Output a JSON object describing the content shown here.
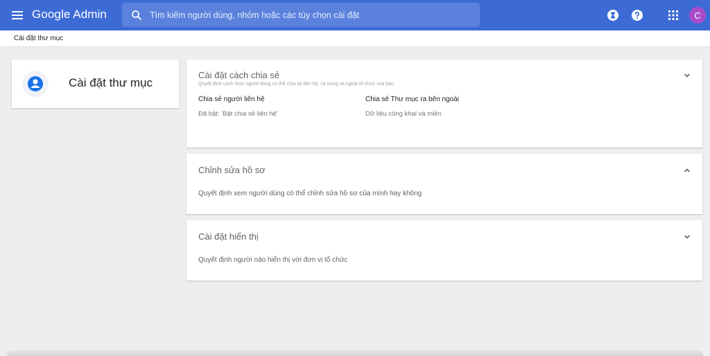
{
  "header": {
    "logo": "Google Admin",
    "search_placeholder": "Tìm kiếm người dùng, nhóm hoặc các tùy chọn cài đặt",
    "avatar_letter": "C"
  },
  "breadcrumb": "Cài đặt thư mục",
  "left_panel": {
    "title": "Cài đặt thư mục"
  },
  "cards": [
    {
      "title": "Cài đặt cách chia sẻ",
      "subtitle": "Quyết định cách thức người dùng có thể chia sẻ liên hệ, cả trong và ngoài tổ chức của bạn",
      "columns": [
        {
          "header": "Chia sẻ người liên hệ",
          "value": "Đã bật: 'Bật chia sẻ liên hệ'"
        },
        {
          "header": "Chia sẻ Thư mục ra bên ngoài",
          "value": "Dữ liệu công khai và miền"
        }
      ]
    },
    {
      "title": "Chỉnh sửa hồ sơ",
      "description": "Quyết định xem người dùng có thể chỉnh sửa hồ sơ của mình hay không"
    },
    {
      "title": "Cài đặt hiển thị",
      "description": "Quyết định người nào hiển thị với đơn vị tổ chức"
    }
  ],
  "colors": {
    "topbar": "#3d6bd6",
    "search_bg": "#5a82dd",
    "avatar": "#a84cc9",
    "background": "#eeeeee",
    "icon_accent": "#1a73e8"
  }
}
